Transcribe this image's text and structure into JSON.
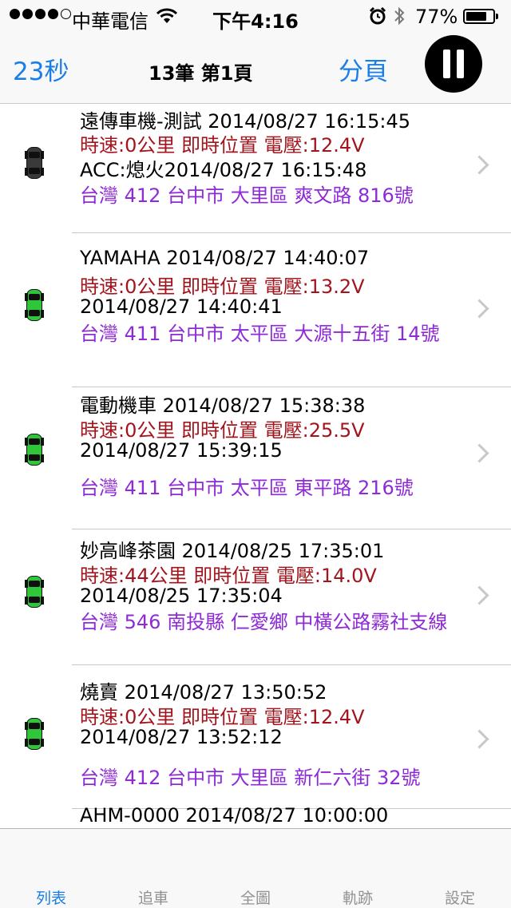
{
  "status_bar": {
    "carrier": "中華電信",
    "time": "下午4:16",
    "battery_percent": "77%",
    "battery_level": 0.77,
    "signal_bars": 4,
    "icons": [
      "signal-dots-icon",
      "wifi-icon",
      "alarm-icon",
      "bluetooth-icon",
      "battery-icon"
    ]
  },
  "nav": {
    "countdown": "23秒",
    "title": "13筆 第1頁",
    "page_button": "分頁",
    "pause_icon": "pause-icon",
    "accent_color": "#1a7ee6"
  },
  "vehicles": [
    {
      "name_line": "遠傳車機-測試  2014/08/27 16:15:45",
      "speed_line": "時速:0公里 即時位置 電壓:12.4V",
      "time_line": "ACC:熄火2014/08/27 16:15:48",
      "address": "台灣 412 台中市 大里區 爽文路 816號",
      "icon": "car-icon",
      "icon_color": "#3a3a3a"
    },
    {
      "name_line": "YAMAHA  2014/08/27 14:40:07",
      "speed_line": "時速:0公里 即時位置 電壓:13.2V",
      "time_line": "2014/08/27 14:40:41",
      "address": "台灣 411 台中市 太平區 大源十五街 14號",
      "icon": "car-icon",
      "icon_color": "#2fc63a"
    },
    {
      "name_line": "電動機車  2014/08/27 15:38:38",
      "speed_line": "時速:0公里 即時位置 電壓:25.5V",
      "time_line": "2014/08/27 15:39:15",
      "address": "台灣 411 台中市 太平區 東平路 216號",
      "icon": "car-icon",
      "icon_color": "#2fc63a"
    },
    {
      "name_line": "妙高峰茶園  2014/08/25 17:35:01",
      "speed_line": "時速:44公里 即時位置 電壓:14.0V",
      "time_line": "2014/08/25 17:35:04",
      "address": "台灣 546 南投縣 仁愛鄉 中橫公路霧社支線",
      "icon": "car-icon",
      "icon_color": "#2fc63a"
    },
    {
      "name_line": "燒賣  2014/08/27 13:50:52",
      "speed_line": "時速:0公里 即時位置 電壓:12.4V",
      "time_line": "2014/08/27 13:52:12",
      "address": "台灣 412 台中市 大里區 新仁六街 32號",
      "icon": "car-icon",
      "icon_color": "#2fc63a"
    }
  ],
  "partial_row": "AHM-0000  2014/08/27 10:00:00",
  "tabs": [
    {
      "label": "列表",
      "active": true
    },
    {
      "label": "追車",
      "active": false
    },
    {
      "label": "全圖",
      "active": false
    },
    {
      "label": "軌跡",
      "active": false
    },
    {
      "label": "設定",
      "active": false
    }
  ],
  "colors": {
    "speed_text": "#a3141c",
    "address_text": "#8e2ad6",
    "tab_active": "#1a7ee6",
    "tab_inactive": "#929292"
  }
}
